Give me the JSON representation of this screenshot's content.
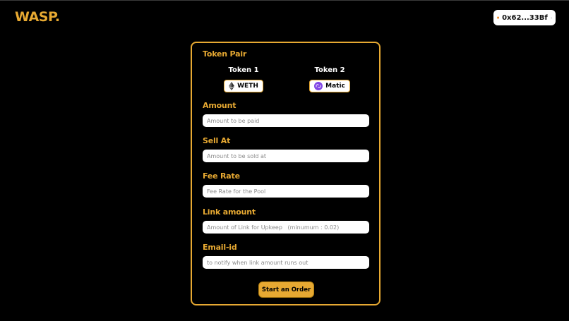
{
  "colors": {
    "accent": "#E7A932",
    "background": "#000000",
    "input_bg": "#FFFFFF"
  },
  "header": {
    "logo": "WASP.",
    "wallet": {
      "address": "0x62...33Bf",
      "avatar_icon": "wallet-avatar-icon",
      "dropdown_icon": "chevron-down-icon"
    }
  },
  "form": {
    "token_pair_title": "Token Pair",
    "token1": {
      "label": "Token 1",
      "symbol": "WETH",
      "icon": "ethereum-icon"
    },
    "token2": {
      "label": "Token 2",
      "symbol": "Matic",
      "icon": "polygon-icon"
    },
    "fields": {
      "amount": {
        "label": "Amount",
        "value": "",
        "placeholder": "Amount to be paid"
      },
      "sell_at": {
        "label": "Sell At",
        "value": "",
        "placeholder": "Amount to be sold at"
      },
      "fee_rate": {
        "label": "Fee Rate",
        "value": "",
        "placeholder": "Fee Rate for the Pool"
      },
      "link_amount": {
        "label": "Link amount",
        "value": "",
        "placeholder": "Amount of Link for Upkeep   (minumum : 0.02)"
      },
      "email": {
        "label": "Email-id",
        "value": "",
        "placeholder": "to notify when link amount runs out"
      }
    },
    "submit_label": "Start an Order"
  }
}
